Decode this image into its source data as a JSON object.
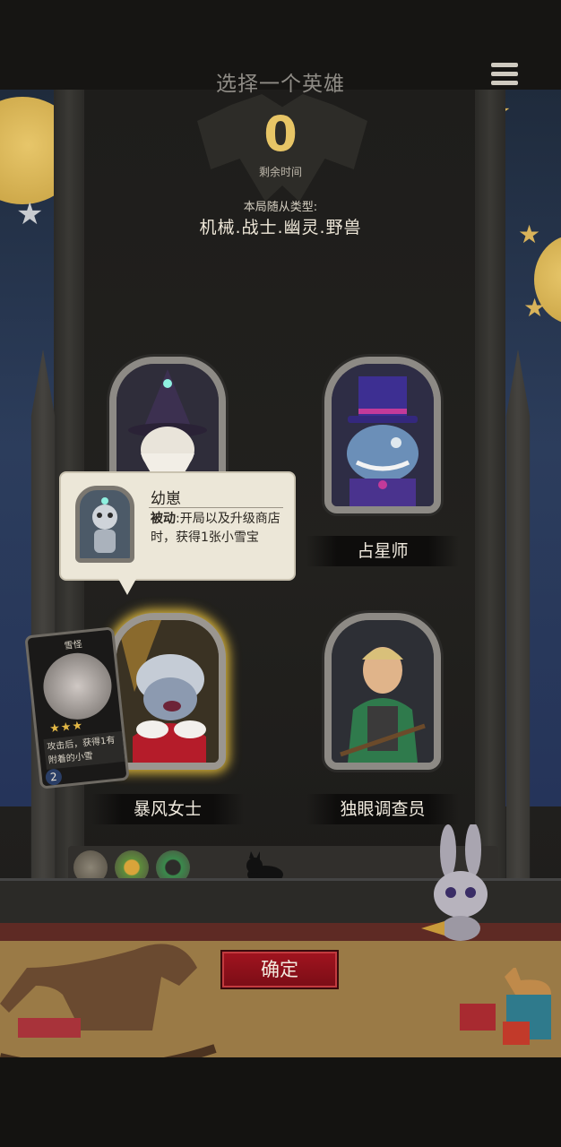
{
  "header": {
    "title": "选择一个英雄",
    "menu_icon": "menu-icon"
  },
  "timer": {
    "value": "0",
    "label": "剩余时间"
  },
  "round_types": {
    "label": "本局随从类型:",
    "value": "机械.战士.幽灵.野兽"
  },
  "heroes": [
    {
      "name": "",
      "portrait": "wizard-icon",
      "selected": false
    },
    {
      "name": "占星师",
      "portrait": "top-hat-monster-icon",
      "selected": false
    },
    {
      "name": "暴风女士",
      "portrait": "storm-lady-icon",
      "selected": true
    },
    {
      "name": "独眼调查员",
      "portrait": "ranger-icon",
      "selected": false
    }
  ],
  "tooltip": {
    "name": "幼崽",
    "keyword": "被动",
    "description": ":开局以及升级商店时，获得1张小雪宝"
  },
  "mini_card": {
    "title": "雪怪",
    "stars": "★★★",
    "text": "攻击后，获得1有附着的小雪",
    "number": "2"
  },
  "confirm_button": "确定",
  "colors": {
    "accent_gold": "#e7c566",
    "confirm_red": "#9a1420",
    "selected_glow": "#d8b43c"
  }
}
